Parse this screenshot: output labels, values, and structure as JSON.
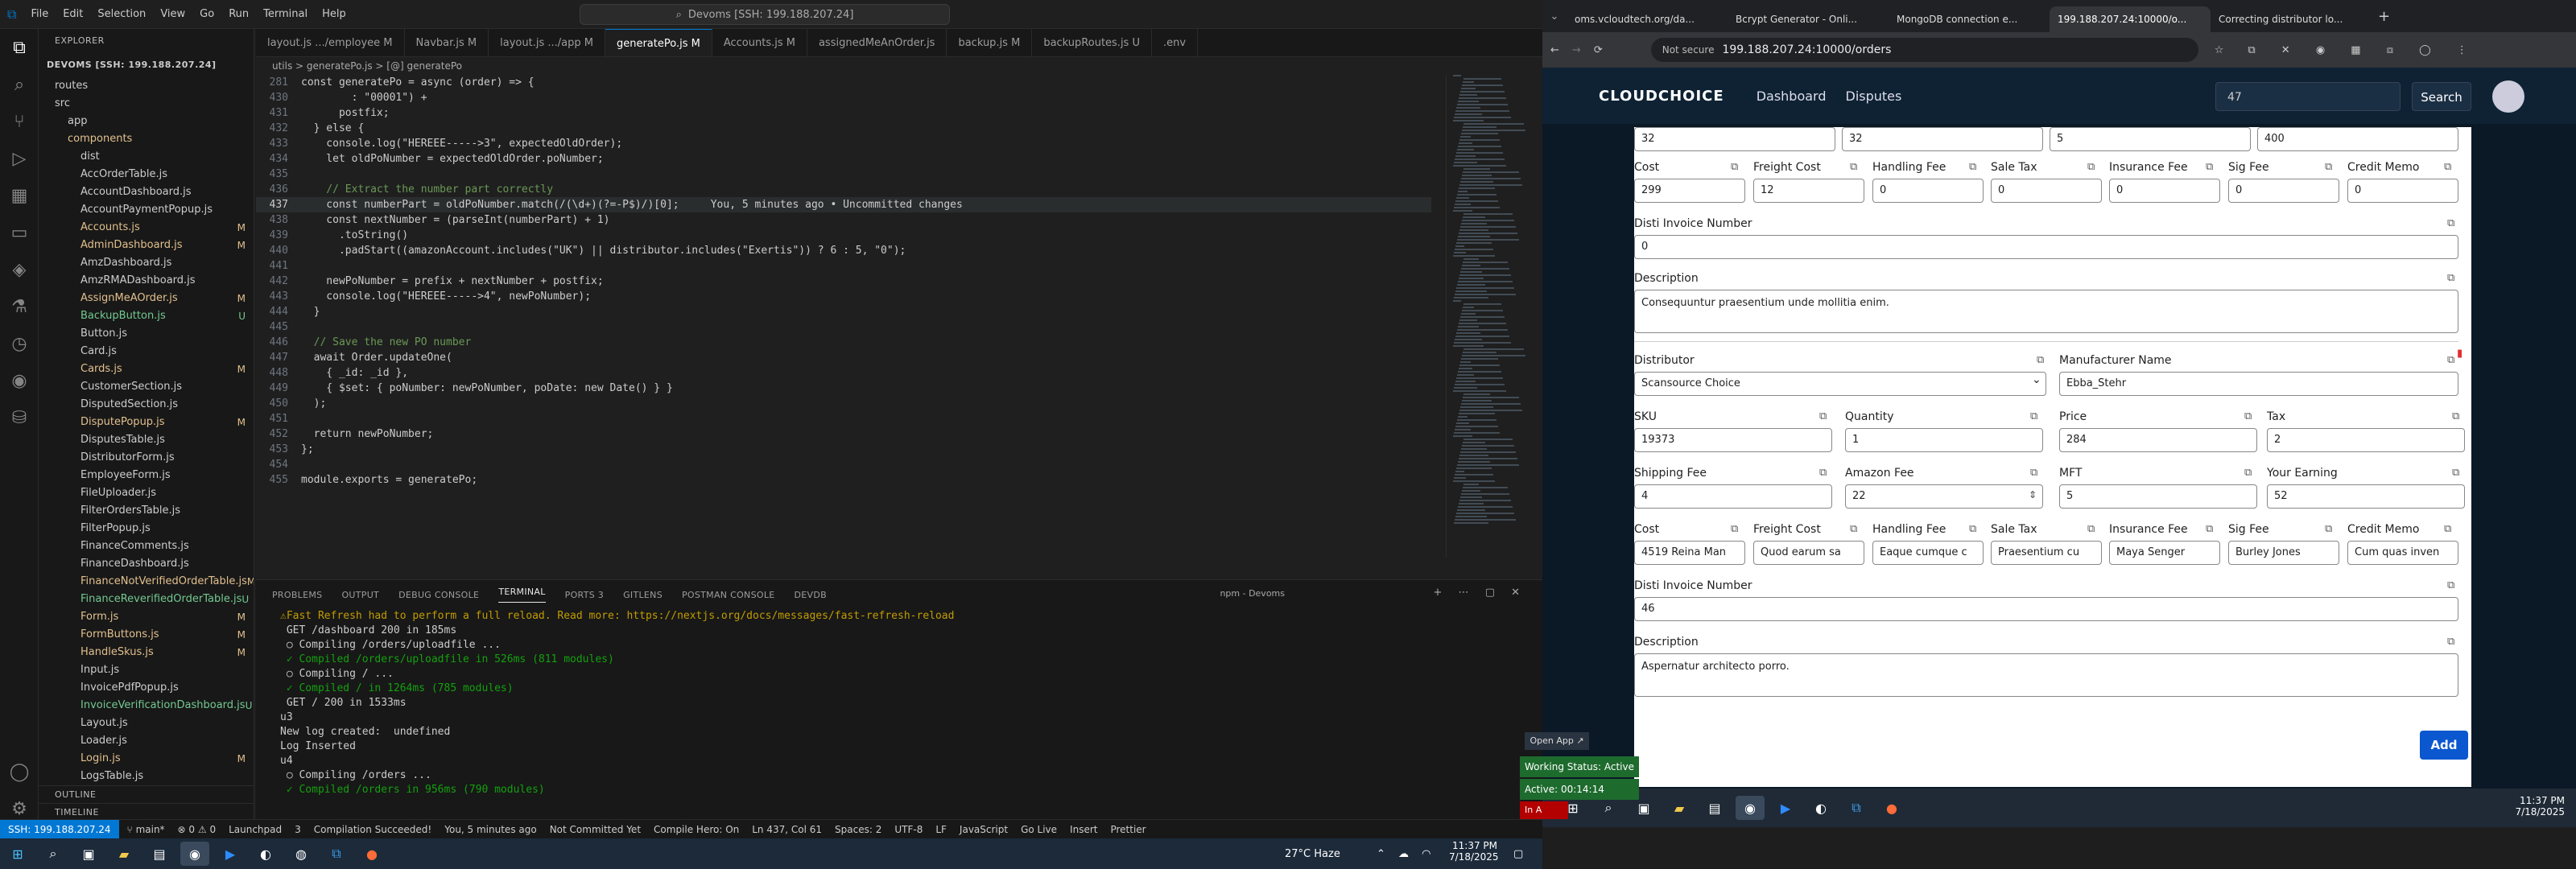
{
  "vscode": {
    "menu": [
      "File",
      "Edit",
      "Selection",
      "View",
      "Go",
      "Run",
      "Terminal",
      "Help"
    ],
    "search": "Devoms [SSH: 199.188.207.24]",
    "explorer_title": "EXPLORER",
    "workspace": "DEVOMS [SSH: 199.188.207.24]",
    "tree": [
      {
        "label": "routes",
        "cls": "",
        "indent": 1,
        "badge": ""
      },
      {
        "label": "src",
        "cls": "",
        "indent": 1,
        "badge": ""
      },
      {
        "label": "app",
        "cls": "",
        "indent": 2,
        "badge": ""
      },
      {
        "label": "components",
        "cls": "mod",
        "indent": 2,
        "badge": ""
      },
      {
        "label": "dist",
        "cls": "",
        "indent": 3,
        "badge": ""
      },
      {
        "label": "AccOrderTable.js",
        "cls": "",
        "indent": 3,
        "badge": ""
      },
      {
        "label": "AccountDashboard.js",
        "cls": "",
        "indent": 3,
        "badge": ""
      },
      {
        "label": "AccountPaymentPopup.js",
        "cls": "",
        "indent": 3,
        "badge": ""
      },
      {
        "label": "Accounts.js",
        "cls": "mod",
        "indent": 3,
        "badge": "M"
      },
      {
        "label": "AdminDashboard.js",
        "cls": "mod",
        "indent": 3,
        "badge": "M"
      },
      {
        "label": "AmzDashboard.js",
        "cls": "",
        "indent": 3,
        "badge": ""
      },
      {
        "label": "AmzRMADashboard.js",
        "cls": "",
        "indent": 3,
        "badge": ""
      },
      {
        "label": "AssignMeAOrder.js",
        "cls": "mod",
        "indent": 3,
        "badge": "M"
      },
      {
        "label": "BackupButton.js",
        "cls": "unt",
        "indent": 3,
        "badge": "U"
      },
      {
        "label": "Button.js",
        "cls": "",
        "indent": 3,
        "badge": ""
      },
      {
        "label": "Card.js",
        "cls": "",
        "indent": 3,
        "badge": ""
      },
      {
        "label": "Cards.js",
        "cls": "mod",
        "indent": 3,
        "badge": "M"
      },
      {
        "label": "CustomerSection.js",
        "cls": "",
        "indent": 3,
        "badge": ""
      },
      {
        "label": "DisputedSection.js",
        "cls": "",
        "indent": 3,
        "badge": ""
      },
      {
        "label": "DisputePopup.js",
        "cls": "mod",
        "indent": 3,
        "badge": "M"
      },
      {
        "label": "DisputesTable.js",
        "cls": "",
        "indent": 3,
        "badge": ""
      },
      {
        "label": "DistributorForm.js",
        "cls": "",
        "indent": 3,
        "badge": ""
      },
      {
        "label": "EmployeeForm.js",
        "cls": "",
        "indent": 3,
        "badge": ""
      },
      {
        "label": "FileUploader.js",
        "cls": "",
        "indent": 3,
        "badge": ""
      },
      {
        "label": "FilterOrdersTable.js",
        "cls": "",
        "indent": 3,
        "badge": ""
      },
      {
        "label": "FilterPopup.js",
        "cls": "",
        "indent": 3,
        "badge": ""
      },
      {
        "label": "FinanceComments.js",
        "cls": "",
        "indent": 3,
        "badge": ""
      },
      {
        "label": "FinanceDashboard.js",
        "cls": "",
        "indent": 3,
        "badge": ""
      },
      {
        "label": "FinanceNotVerifiedOrderTable.js",
        "cls": "mod",
        "indent": 3,
        "badge": "M"
      },
      {
        "label": "FinanceReverifiedOrderTable.js",
        "cls": "unt",
        "indent": 3,
        "badge": "U"
      },
      {
        "label": "Form.js",
        "cls": "mod",
        "indent": 3,
        "badge": "M"
      },
      {
        "label": "FormButtons.js",
        "cls": "mod",
        "indent": 3,
        "badge": "M"
      },
      {
        "label": "HandleSkus.js",
        "cls": "mod",
        "indent": 3,
        "badge": "M"
      },
      {
        "label": "Input.js",
        "cls": "",
        "indent": 3,
        "badge": ""
      },
      {
        "label": "InvoicePdfPopup.js",
        "cls": "",
        "indent": 3,
        "badge": ""
      },
      {
        "label": "InvoiceVerificationDashboard.js",
        "cls": "unt",
        "indent": 3,
        "badge": "U"
      },
      {
        "label": "Layout.js",
        "cls": "",
        "indent": 3,
        "badge": ""
      },
      {
        "label": "Loader.js",
        "cls": "",
        "indent": 3,
        "badge": ""
      },
      {
        "label": "Login.js",
        "cls": "mod",
        "indent": 3,
        "badge": "M"
      },
      {
        "label": "LogsTable.js",
        "cls": "",
        "indent": 3,
        "badge": ""
      }
    ],
    "outline": "OUTLINE",
    "timeline": "TIMELINE",
    "tabs": [
      "layout.js .../employee M",
      "Navbar.js M",
      "layout.js .../app M",
      "generatePo.js M",
      "Accounts.js M",
      "assignedMeAnOrder.js",
      "backup.js M",
      "backupRoutes.js U",
      ".env"
    ],
    "breadcrumbs": "utils > generatePo.js > [@] generatePo",
    "code": [
      {
        "n": "281",
        "t": "const generatePo = async (order) => {"
      },
      {
        "n": "430",
        "t": "        : \"00001\") +"
      },
      {
        "n": "431",
        "t": "      postfix;"
      },
      {
        "n": "432",
        "t": "  } else {"
      },
      {
        "n": "433",
        "t": "    console.log(\"HEREEE----->3\", expectedOldOrder);"
      },
      {
        "n": "434",
        "t": "    let oldPoNumber = expectedOldOrder.poNumber;"
      },
      {
        "n": "435",
        "t": ""
      },
      {
        "n": "436",
        "t": "    // Extract the number part correctly"
      },
      {
        "n": "437",
        "t": "    const numberPart = oldPoNumber.match(/(\\d+)(?=-P$)/)[0];     You, 5 minutes ago • Uncommitted changes"
      },
      {
        "n": "438",
        "t": "    const nextNumber = (parseInt(numberPart) + 1)"
      },
      {
        "n": "439",
        "t": "      .toString()"
      },
      {
        "n": "440",
        "t": "      .padStart((amazonAccount.includes(\"UK\") || distributor.includes(\"Exertis\")) ? 6 : 5, \"0\");"
      },
      {
        "n": "441",
        "t": ""
      },
      {
        "n": "442",
        "t": "    newPoNumber = prefix + nextNumber + postfix;"
      },
      {
        "n": "443",
        "t": "    console.log(\"HEREEE----->4\", newPoNumber);"
      },
      {
        "n": "444",
        "t": "  }"
      },
      {
        "n": "445",
        "t": ""
      },
      {
        "n": "446",
        "t": "  // Save the new PO number"
      },
      {
        "n": "447",
        "t": "  await Order.updateOne("
      },
      {
        "n": "448",
        "t": "    { _id: _id },"
      },
      {
        "n": "449",
        "t": "    { $set: { poNumber: newPoNumber, poDate: new Date() } }"
      },
      {
        "n": "450",
        "t": "  );"
      },
      {
        "n": "451",
        "t": ""
      },
      {
        "n": "452",
        "t": "  return newPoNumber;"
      },
      {
        "n": "453",
        "t": "};"
      },
      {
        "n": "454",
        "t": ""
      },
      {
        "n": "455",
        "t": "module.exports = generatePo;"
      }
    ],
    "panel_tabs": [
      "PROBLEMS",
      "OUTPUT",
      "DEBUG CONSOLE",
      "TERMINAL",
      "PORTS 3",
      "GITLENS",
      "POSTMAN CONSOLE",
      "DEVDB"
    ],
    "terminal_title": "npm - Devoms",
    "terminal": [
      {
        "t": "⚠Fast Refresh had to perform a full reload. Read more: https://nextjs.org/docs/messages/fast-refresh-reload",
        "c": "warn"
      },
      {
        "t": " GET /dashboard 200 in 185ms",
        "c": ""
      },
      {
        "t": " ○ Compiling /orders/uploadfile ...",
        "c": ""
      },
      {
        "t": " ✓ Compiled /orders/uploadfile in 526ms (811 modules)",
        "c": "ok"
      },
      {
        "t": " ○ Compiling / ...",
        "c": ""
      },
      {
        "t": " ✓ Compiled / in 1264ms (785 modules)",
        "c": "ok"
      },
      {
        "t": " GET / 200 in 1533ms",
        "c": ""
      },
      {
        "t": "u3",
        "c": ""
      },
      {
        "t": "New log created:  undefined",
        "c": ""
      },
      {
        "t": "Log Inserted",
        "c": ""
      },
      {
        "t": "u4",
        "c": ""
      },
      {
        "t": " ○ Compiling /orders ...",
        "c": ""
      },
      {
        "t": " ✓ Compiled /orders in 956ms (790 modules)",
        "c": "ok"
      }
    ],
    "status": {
      "remote": "SSH: 199.188.207.24",
      "branch": "main*",
      "problems": "⊗ 0 ⚠ 0",
      "launch": "Launchpad",
      "ports": "3",
      "compile": "Compilation Succeeded!",
      "blame": "You, 5 minutes ago",
      "commit": "Not Committed Yet",
      "hero": "Compile Hero: On",
      "pos": "Ln 437, Col 61",
      "spaces": "Spaces: 2",
      "enc": "UTF-8",
      "eol": "LF",
      "lang": "JavaScript",
      "golive": "Go Live",
      "insert": "Insert",
      "prettier": "Prettier"
    }
  },
  "chrome": {
    "tabs": [
      "oms.vcloudtech.org/da...",
      "Bcrypt Generator - Onli...",
      "MongoDB connection e...",
      "199.188.207.24:10000/o...",
      "Correcting distributor lo..."
    ],
    "not_secure": "Not secure",
    "url": "199.188.207.24:10000/orders"
  },
  "app": {
    "logo": "CLOUDCHOICE",
    "nav": [
      "Dashboard",
      "Disputes"
    ],
    "search_value": "47",
    "search_button": "Search",
    "form": {
      "top_row": [
        "32",
        "32",
        "5",
        "400"
      ],
      "cost_labels": [
        "Cost",
        "Freight Cost",
        "Handling Fee",
        "Sale Tax",
        "Insurance Fee",
        "Sig Fee",
        "Credit Memo"
      ],
      "cost_values_1": [
        "299",
        "12",
        "0",
        "0",
        "0",
        "0",
        "0"
      ],
      "disti_label": "Disti Invoice Number",
      "disti_value_1": "0",
      "desc_label": "Description",
      "desc_value_1": "Consequuntur praesentium unde mollitia enim.",
      "distributor_label": "Distributor",
      "distributor_value": "Scansource Choice",
      "manufacturer_label": "Manufacturer Name",
      "manufacturer_value": "Ebba_Stehr",
      "row2_labels": [
        "SKU",
        "Quantity",
        "Price",
        "Tax"
      ],
      "row2_values": [
        "19373",
        "1",
        "284",
        "2"
      ],
      "row3_labels": [
        "Shipping Fee",
        "Amazon Fee",
        "MFT",
        "Your Earning"
      ],
      "row3_values": [
        "4",
        "22",
        "5",
        "52"
      ],
      "cost_values_2": [
        "4519 Reina Man",
        "Quod earum sa",
        "Eaque cumque c",
        "Praesentium cu",
        "Maya Senger",
        "Burley Jones",
        "Cum quas inven"
      ],
      "disti_value_2": "46",
      "desc_value_2": "Aspernatur architecto porro.",
      "add_button": "Add"
    }
  },
  "overlays": {
    "open_app": "Open App ↗",
    "working_status": "Working Status: Active",
    "active": "Active: 00:14:14",
    "in": "In A"
  },
  "taskbar_left": {
    "weather": "27°C  Haze",
    "time": "11:37 PM",
    "date": "7/18/2025"
  },
  "taskbar_right": {
    "time": "11:37 PM",
    "date": "7/18/2025"
  }
}
